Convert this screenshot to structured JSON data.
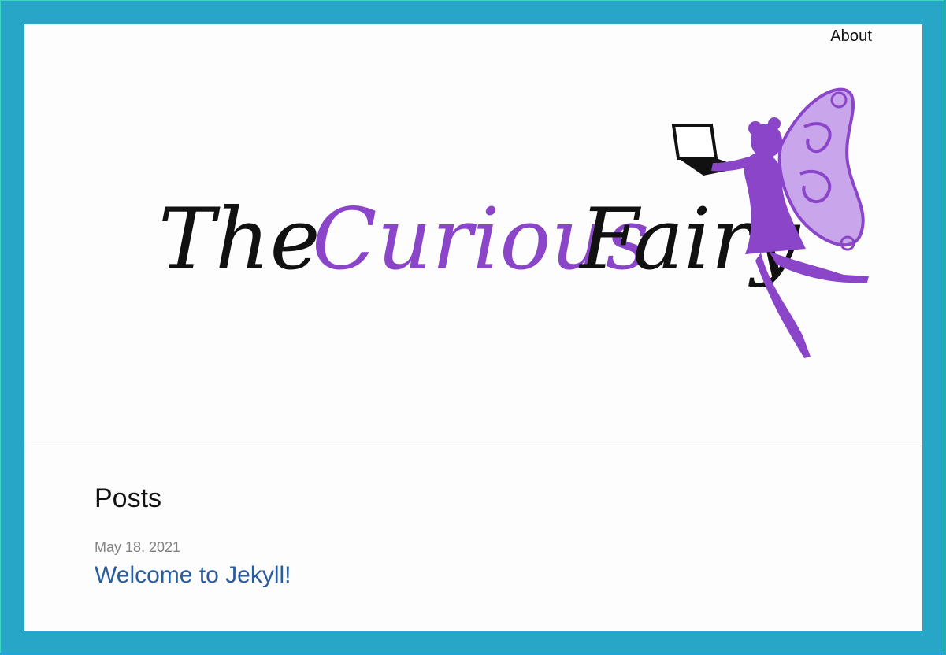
{
  "nav": {
    "about": "About"
  },
  "logo": {
    "word1": "The",
    "word2": "Curious",
    "word3": "Fairy",
    "accent": "#8a45c9",
    "ink": "#111111"
  },
  "posts": {
    "heading": "Posts",
    "items": [
      {
        "date": "May 18, 2021",
        "title": "Welcome to Jekyll!"
      }
    ]
  },
  "colors": {
    "frame": "#27a6c8",
    "link": "#2a5d9f",
    "meta": "#828282"
  }
}
